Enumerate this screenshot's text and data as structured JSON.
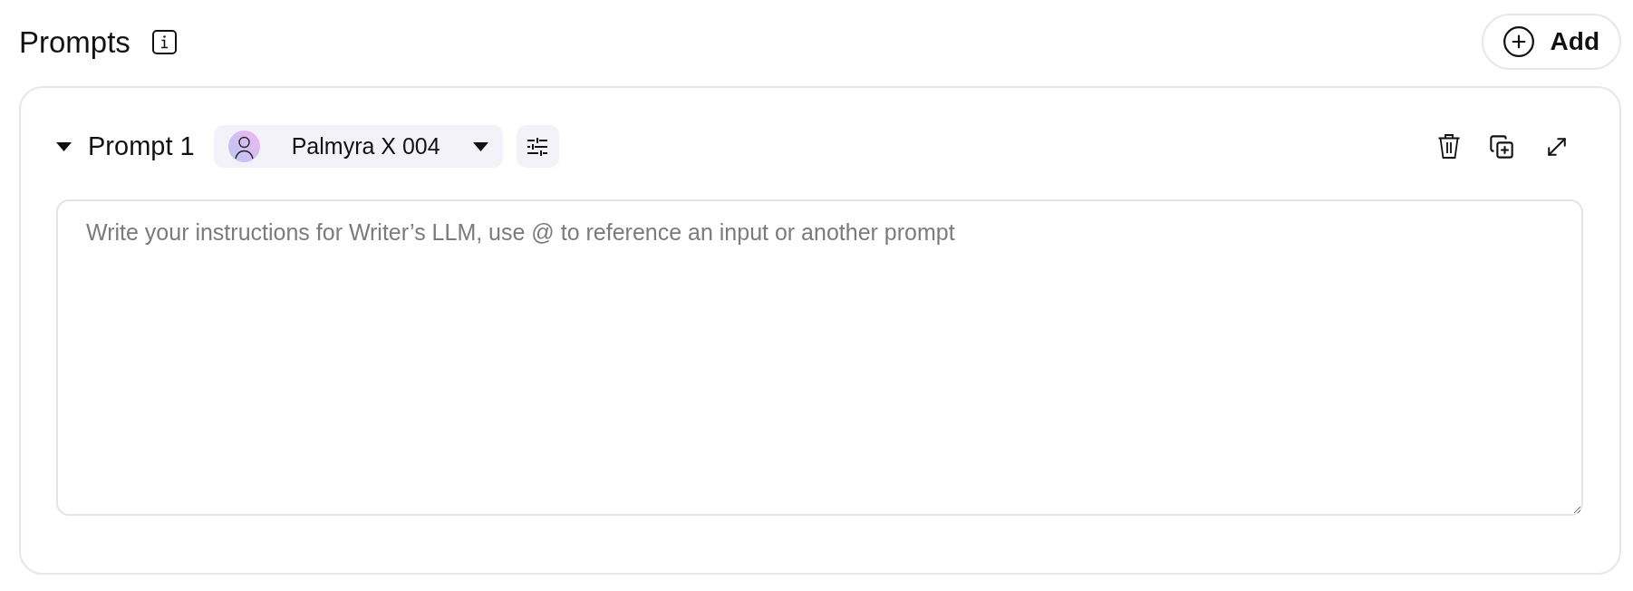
{
  "header": {
    "title": "Prompts",
    "add_button": "Add"
  },
  "prompts": [
    {
      "title": "Prompt 1",
      "expanded": true,
      "model": "Palmyra X 004",
      "editor": {
        "placeholder": "Write your instructions for Writer’s LLM, use @ to reference an input or another prompt"
      }
    }
  ]
}
